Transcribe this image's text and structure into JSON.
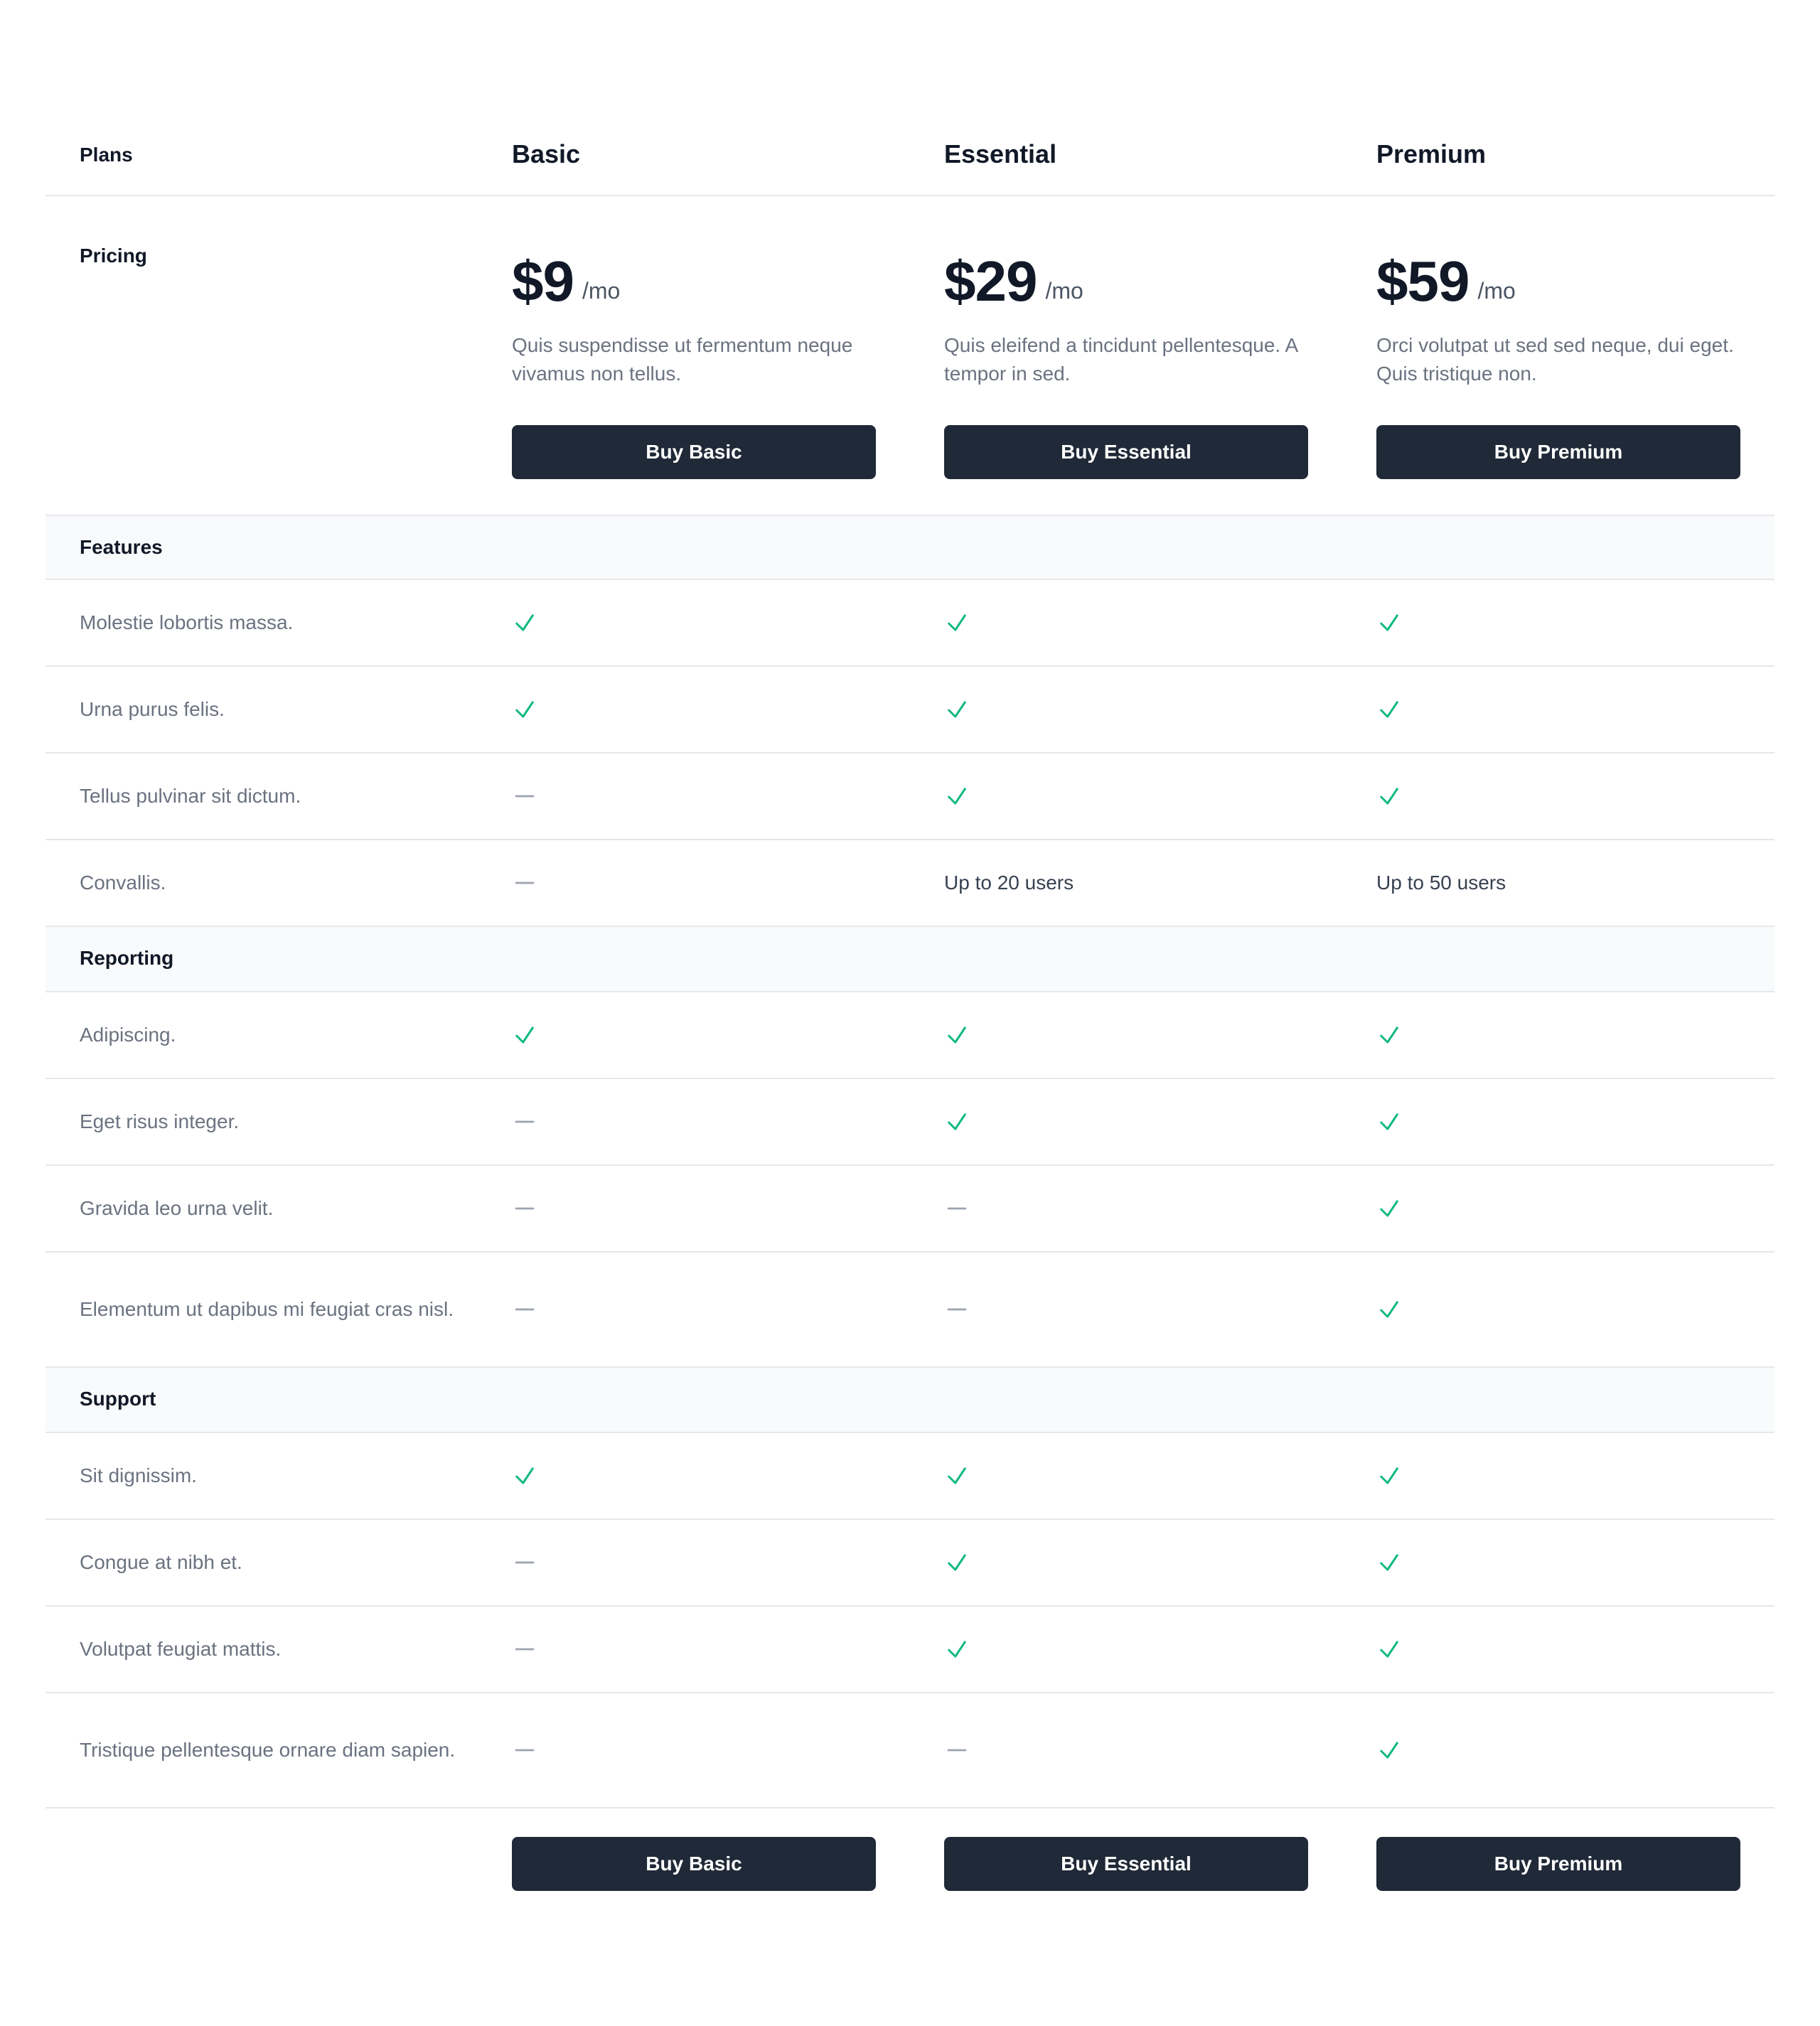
{
  "header": {
    "plans_label": "Plans",
    "plans": [
      {
        "name": "Basic"
      },
      {
        "name": "Essential"
      },
      {
        "name": "Premium"
      }
    ]
  },
  "pricing": {
    "label": "Pricing",
    "plans": [
      {
        "amount": "$9",
        "period": "/mo",
        "description": "Quis suspendisse ut fermentum neque vivamus non tellus.",
        "button": "Buy Basic"
      },
      {
        "amount": "$29",
        "period": "/mo",
        "description": "Quis eleifend a tincidunt pellentesque. A tempor in sed.",
        "button": "Buy Essential"
      },
      {
        "amount": "$59",
        "period": "/mo",
        "description": "Orci volutpat ut sed sed neque, dui eget. Quis tristique non.",
        "button": "Buy Premium"
      }
    ]
  },
  "sections": [
    {
      "title": "Features",
      "rows": [
        {
          "name": "Molestie lobortis massa.",
          "cells": [
            "check",
            "check",
            "check"
          ]
        },
        {
          "name": "Urna purus felis.",
          "cells": [
            "check",
            "check",
            "check"
          ]
        },
        {
          "name": "Tellus pulvinar sit dictum.",
          "cells": [
            "dash",
            "check",
            "check"
          ]
        },
        {
          "name": "Convallis.",
          "cells": [
            "dash",
            "Up to 20 users",
            "Up to 50 users"
          ]
        }
      ]
    },
    {
      "title": "Reporting",
      "rows": [
        {
          "name": "Adipiscing.",
          "cells": [
            "check",
            "check",
            "check"
          ]
        },
        {
          "name": "Eget risus integer.",
          "cells": [
            "dash",
            "check",
            "check"
          ]
        },
        {
          "name": "Gravida leo urna velit.",
          "cells": [
            "dash",
            "dash",
            "check"
          ]
        },
        {
          "name": "Elementum ut dapibus mi feugiat cras nisl.",
          "cells": [
            "dash",
            "dash",
            "check"
          ]
        }
      ]
    },
    {
      "title": "Support",
      "rows": [
        {
          "name": "Sit dignissim.",
          "cells": [
            "check",
            "check",
            "check"
          ]
        },
        {
          "name": "Congue at nibh et.",
          "cells": [
            "dash",
            "check",
            "check"
          ]
        },
        {
          "name": "Volutpat feugiat mattis.",
          "cells": [
            "dash",
            "check",
            "check"
          ]
        },
        {
          "name": "Tristique pellentesque ornare diam sapien.",
          "cells": [
            "dash",
            "dash",
            "check"
          ]
        }
      ]
    }
  ],
  "footer": {
    "buttons": [
      "Buy Basic",
      "Buy Essential",
      "Buy Premium"
    ]
  },
  "icons": {
    "check": "check-icon",
    "dash": "dash-icon"
  },
  "colors": {
    "check": "#10b981",
    "dash": "#9ca3af",
    "button": "#1f2937",
    "section_bg": "#f9fafb",
    "border": "#e5e7eb"
  }
}
